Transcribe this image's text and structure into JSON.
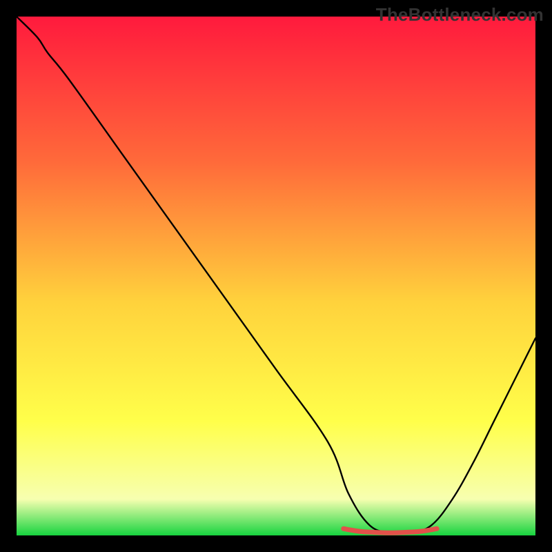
{
  "watermark": "TheBottleneck.com",
  "colors": {
    "frame": "#000000",
    "gradient_top": "#ff1a3d",
    "gradient_mid_upper": "#ff6a3a",
    "gradient_mid": "#ffd23c",
    "gradient_mid_lower": "#ffff4a",
    "gradient_lower": "#f7ffb0",
    "gradient_bottom": "#17d43f",
    "curve": "#000000",
    "highlight": "#e2514a"
  },
  "chart_data": {
    "type": "line",
    "title": "",
    "xlabel": "",
    "ylabel": "",
    "xlim": [
      0,
      100
    ],
    "ylim": [
      0,
      100
    ],
    "series": [
      {
        "name": "bottleneck-curve",
        "x": [
          0,
          4,
          6,
          10,
          20,
          30,
          40,
          50,
          60,
          64,
          68,
          72,
          76,
          80,
          84,
          88,
          92,
          96,
          100
        ],
        "values": [
          100,
          96,
          93,
          88,
          74,
          60,
          46,
          32,
          18,
          8,
          2,
          0.5,
          0.5,
          2,
          7,
          14,
          22,
          30,
          38
        ]
      },
      {
        "name": "optimal-range-highlight",
        "x": [
          63,
          66,
          69,
          72,
          75,
          78,
          81
        ],
        "values": [
          1.3,
          0.8,
          0.6,
          0.5,
          0.6,
          0.8,
          1.3
        ]
      }
    ],
    "annotations": []
  }
}
